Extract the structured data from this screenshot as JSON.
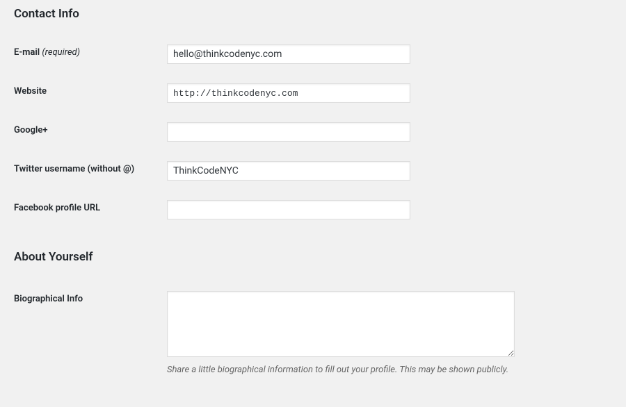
{
  "sections": {
    "contact": {
      "heading": "Contact Info",
      "fields": {
        "email": {
          "label": "E-mail ",
          "required_text": "(required)",
          "value": "hello@thinkcodenyc.com"
        },
        "website": {
          "label": "Website",
          "value": "http://thinkcodenyc.com"
        },
        "googleplus": {
          "label": "Google+",
          "value": ""
        },
        "twitter": {
          "label": "Twitter username (without @)",
          "value": "ThinkCodeNYC"
        },
        "facebook": {
          "label": "Facebook profile URL",
          "value": ""
        }
      }
    },
    "about": {
      "heading": "About Yourself",
      "fields": {
        "bio": {
          "label": "Biographical Info",
          "value": "",
          "description": "Share a little biographical information to fill out your profile. This may be shown publicly."
        }
      }
    }
  }
}
